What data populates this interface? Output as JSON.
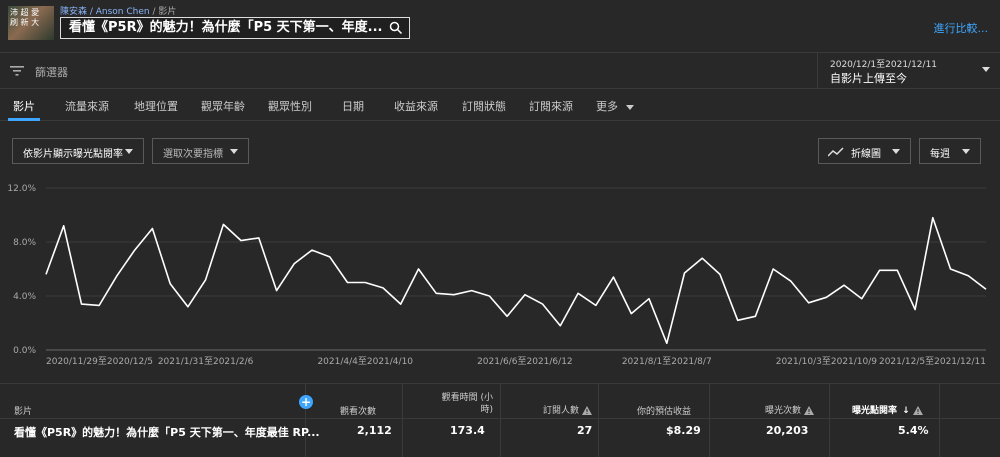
{
  "header": {
    "thumbnail_text": "沛 超 愛\n刷 新 大",
    "breadcrumb": [
      "陳安森 / Anson Chen",
      "影片"
    ],
    "video_title": "看懂《P5R》的魅力！為什麼「P5 天下第一、年度...",
    "compare_label": "進行比較..."
  },
  "filter": {
    "label": "篩選器",
    "date_range": "2020/12/1至2021/12/11",
    "date_scope": "自影片上傳至今"
  },
  "tabs": [
    "影片",
    "流量來源",
    "地理位置",
    "觀眾年齡",
    "觀眾性別",
    "日期",
    "收益來源",
    "訂閱狀態",
    "訂閱來源",
    "更多"
  ],
  "controls": {
    "metric_dropdown": "依影片顯示曝光點閱率",
    "secondary_dropdown": "選取次要指標",
    "chart_type": "折線圖",
    "interval": "每週"
  },
  "chart_data": {
    "type": "line",
    "y_ticks": [
      "12.0%",
      "8.0%",
      "4.0%",
      "0.0%"
    ],
    "ylim": [
      0,
      12
    ],
    "x_tick_labels": [
      "2020/11/29至2020/12/5",
      "2021/1/31至2021/2/6",
      "2021/4/4至2021/4/10",
      "2021/6/6至2021/6/12",
      "2021/8/1至2021/8/7",
      "2021/10/3至2021/10/9",
      "2021/12/5至2021/12/11"
    ],
    "x_tick_indices": [
      0,
      9,
      18,
      27,
      35,
      44,
      53
    ],
    "series": [
      {
        "values": [
          5.6,
          9.2,
          3.4,
          3.3,
          5.5,
          7.4,
          9.0,
          4.9,
          3.2,
          5.2,
          9.3,
          8.1,
          8.3,
          4.4,
          6.4,
          7.4,
          6.9,
          5.0,
          5.0,
          4.6,
          3.4,
          6.0,
          4.2,
          4.1,
          4.4,
          4.0,
          2.5,
          4.1,
          3.4,
          1.8,
          4.2,
          3.3,
          5.4,
          2.7,
          3.8,
          0.5,
          5.7,
          6.8,
          5.6,
          2.2,
          2.5,
          6.0,
          5.1,
          3.5,
          3.9,
          4.8,
          3.8,
          5.9,
          5.9,
          3.0,
          9.8,
          6.0,
          5.5,
          4.5
        ]
      }
    ]
  },
  "table": {
    "headers": {
      "video": "影片",
      "views": "觀看次數",
      "watch_time": "觀看時間 (小\n時)",
      "subscribers": "訂閱人數",
      "revenue": "你的預估收益",
      "impressions": "曝光次數",
      "ctr": "曝光點閱率"
    },
    "row": {
      "video": "看懂《P5R》的魅力！為什麼「P5 天下第一、年度最佳 RP...",
      "views": "2,112",
      "watch_time": "173.4",
      "subscribers": "27",
      "revenue": "$8.29",
      "impressions": "20,203",
      "ctr": "5.4%"
    }
  },
  "colors": {
    "accent": "#3ea6ff",
    "background": "#282828",
    "line": "#ffffff"
  }
}
